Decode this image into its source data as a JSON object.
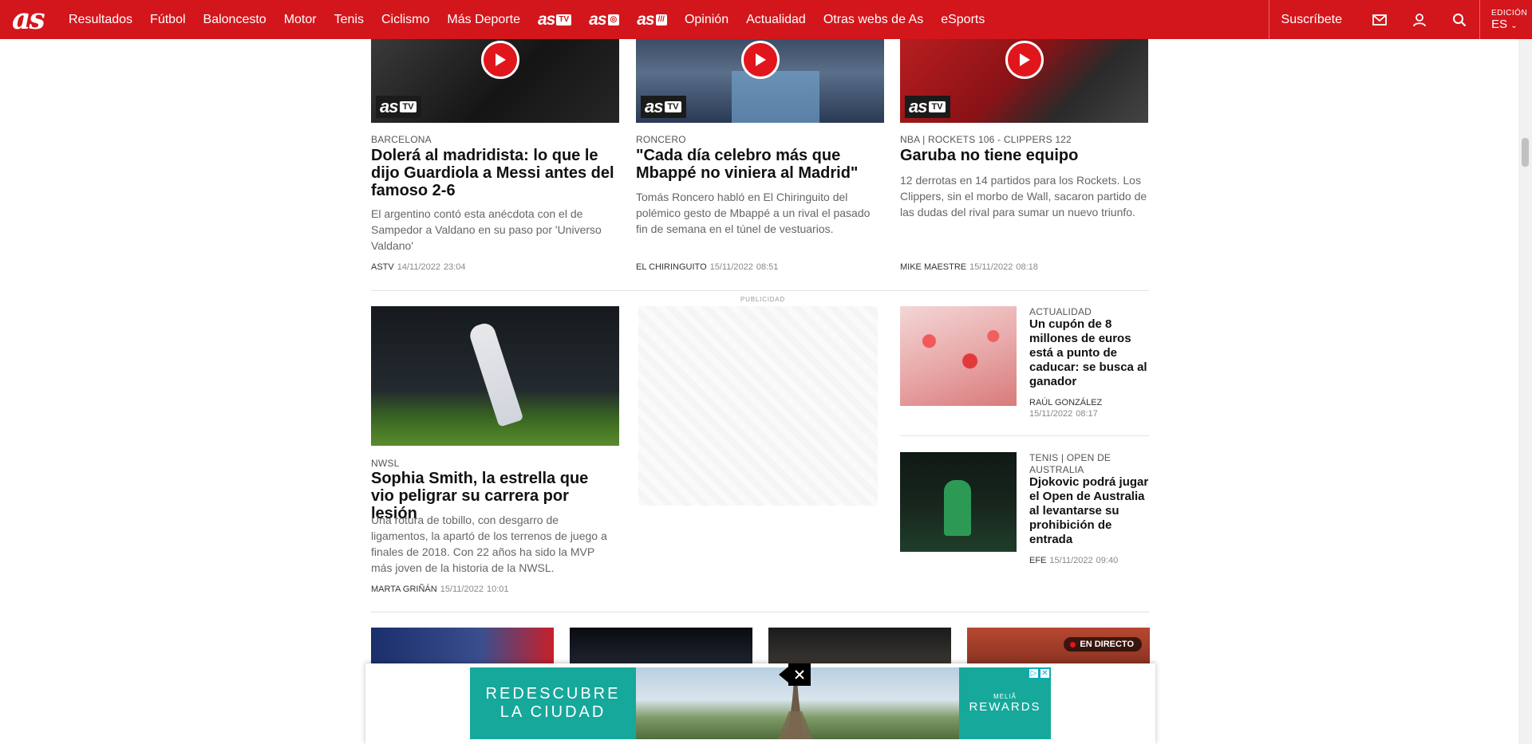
{
  "header": {
    "logo": "as",
    "nav": [
      "Resultados",
      "Fútbol",
      "Baloncesto",
      "Motor",
      "Tenis",
      "Ciclismo",
      "Más Deporte"
    ],
    "nav_logos": [
      {
        "text": "as",
        "box": "TV",
        "name": "as-tv-logo"
      },
      {
        "text": "as",
        "box": "◎",
        "name": "as-photo-logo"
      },
      {
        "text": "as",
        "box": "///",
        "name": "as-audio-logo"
      }
    ],
    "nav2": [
      "Opinión",
      "Actualidad",
      "Otras webs de As",
      "eSports"
    ],
    "subscribe": "Suscríbete",
    "edition_label": "EDICIÓN",
    "edition_value": "ES"
  },
  "video_articles": [
    {
      "kicker": "BARCELONA",
      "title": "Dolerá al madridista: lo que le dijo Guardiola a Messi antes del famoso 2-6",
      "summary": "El argentino contó esta anécdota con el de Sampedor a Valdano en su paso por 'Universo Valdano'",
      "author": "ASTV",
      "date": "14/11/2022",
      "time": "23:04",
      "badge": "as",
      "badge_box": "TV"
    },
    {
      "kicker": "RONCERO",
      "title": "\"Cada día celebro más que Mbappé no viniera al Madrid\"",
      "summary": "Tomás Roncero habló en El Chiringuito del polémico gesto de Mbappé a un rival el pasado fin de semana en el túnel de vestuarios.",
      "author": "EL CHIRINGUITO",
      "date": "15/11/2022",
      "time": "08:51",
      "badge": "as",
      "badge_box": "TV"
    },
    {
      "kicker": "NBA | ROCKETS 106 - CLIPPERS 122",
      "title": "Garuba no tiene equipo",
      "summary": "12 derrotas en 14 partidos para los Rockets. Los Clippers, sin el morbo de Wall, sacaron partido de las dudas del rival para sumar un nuevo triunfo.",
      "author": "MIKE MAESTRE",
      "date": "15/11/2022",
      "time": "08:18",
      "badge": "as",
      "badge_box": "TV"
    }
  ],
  "feature": {
    "kicker": "NWSL",
    "title": "Sophia Smith, la estrella que vio peligrar su carrera por lesión",
    "summary": "Una rotura de tobillo, con desgarro de ligamentos, la apartó de los terrenos de juego a finales de 2018. Con 22 años ha sido la MVP más joven de la historia de la NWSL.",
    "author": "MARTA GRIÑÁN",
    "date": "15/11/2022",
    "time": "10:01"
  },
  "ad_label": "PUBLICIDAD",
  "side_articles": [
    {
      "kicker": "ACTUALIDAD",
      "title": "Un cupón de 8 millones de euros está a punto de caducar: se busca al ganador",
      "author": "RAÚL GONZÁLEZ",
      "date": "15/11/2022",
      "time": "08:17"
    },
    {
      "kicker": "TENIS | OPEN DE AUSTRALIA",
      "title": "Djokovic podrá jugar el Open de Australia al levantarse su prohibición de entrada",
      "author": "EFE",
      "date": "15/11/2022",
      "time": "09:40"
    }
  ],
  "live_badge": "EN DIRECTO",
  "banner": {
    "left_line1": "REDESCUBRE",
    "left_line2": "LA CIUDAD",
    "right_small": "MELIÃ",
    "right_big": "REWARDS"
  }
}
